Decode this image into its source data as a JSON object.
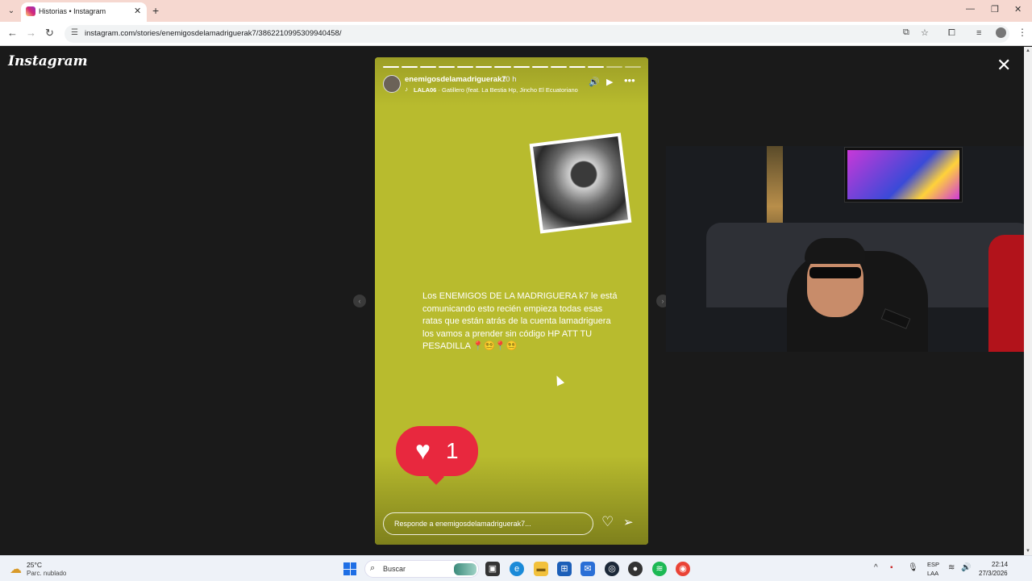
{
  "browser": {
    "tab_title": "Historias • Instagram",
    "url": "instagram.com/stories/enemigosdelamadriguerak7/3862210995309940458/"
  },
  "page": {
    "logo": "Instagram",
    "close_icon": "close-icon"
  },
  "story": {
    "progress": {
      "total_segments": 14,
      "completed_segments": 12
    },
    "username": "enemigosdelamadriguerak7",
    "time": "10 h",
    "song_artist": "LALA06",
    "song_title": "· Gatillero (feat. La Bestia Hp, Jincho El Ecuatoriano",
    "text": "Los ENEMIGOS DE LA MADRIGUERA k7 le está comunicando esto recién empieza todas esas ratas que están atrás de la cuenta lamadriguera los vamos a prender sin código HP ATT  TU PESADILLA 📍😵‍💫📍😵‍💫",
    "like_count": "1",
    "reply_placeholder": "Responde a enemigosdelamadriguerak7...",
    "background_color": "#b8bb2e",
    "like_color": "#e8283e"
  },
  "taskbar": {
    "weather_temp": "25°C",
    "weather_desc": "Parc. nublado",
    "search_label": "Buscar",
    "lang1": "ESP",
    "lang2": "LAA",
    "time": "22:14",
    "date": "27/3/2026"
  }
}
